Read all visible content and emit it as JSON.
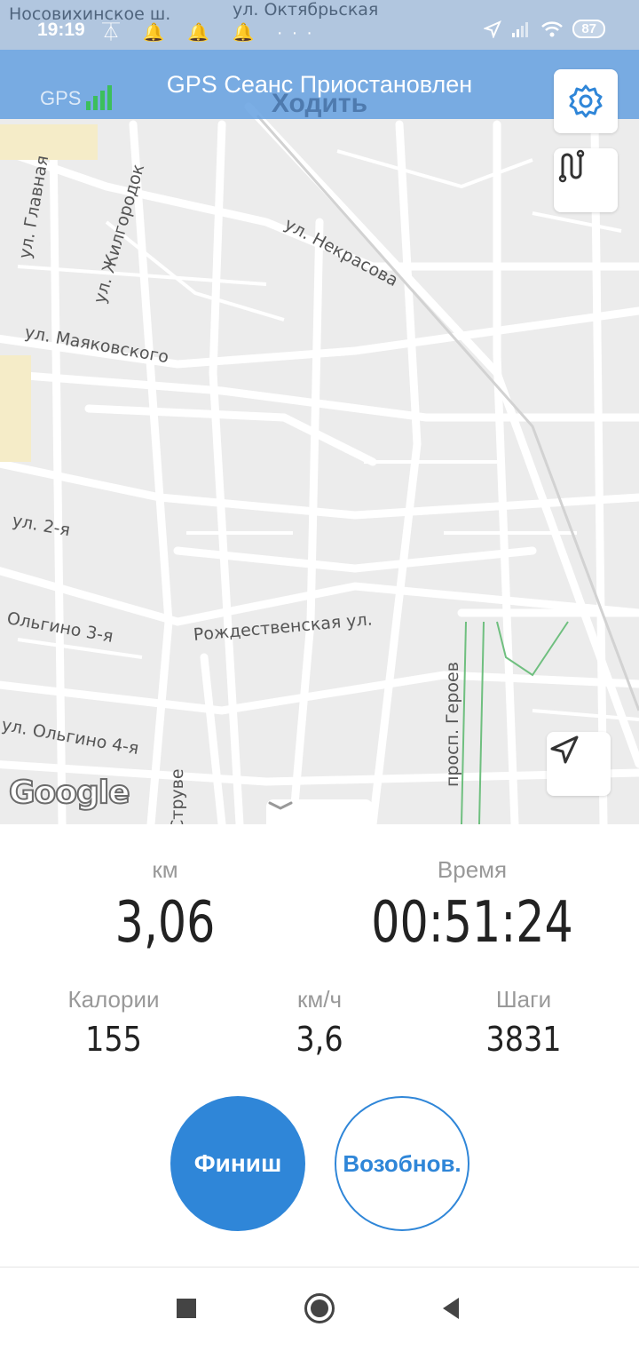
{
  "status_bar": {
    "time": "19:19",
    "notification_icons": "⏄ 🔔 🔔 🔔 ···",
    "battery": "87"
  },
  "header": {
    "title": "GPS Сеанс Приостановлен",
    "mode": "Ходить",
    "gps_label": "GPS"
  },
  "map": {
    "streets": [
      "Носовихинское ш.",
      "ул. Октябрьская",
      "ул. Главная",
      "ул. Жилгородок",
      "ул. Некрасова",
      "ул. Маяковского",
      "ул. 2-я",
      "Ольгино 3-я",
      "Рождественская ул.",
      "просп. Героев",
      "ул. Ольгино 4-я",
      "Струве"
    ],
    "attribution": "Google"
  },
  "stats": {
    "distance_label": "км",
    "distance_value": "3,06",
    "time_label": "Время",
    "time_value": "00:51:24",
    "calories_label": "Калории",
    "calories_value": "155",
    "speed_label": "км/ч",
    "speed_value": "3,6",
    "steps_label": "Шаги",
    "steps_value": "3831"
  },
  "buttons": {
    "finish": "Финиш",
    "resume": "Возобнов."
  },
  "colors": {
    "accent": "#2f86d8",
    "header": "#64a0e1"
  }
}
